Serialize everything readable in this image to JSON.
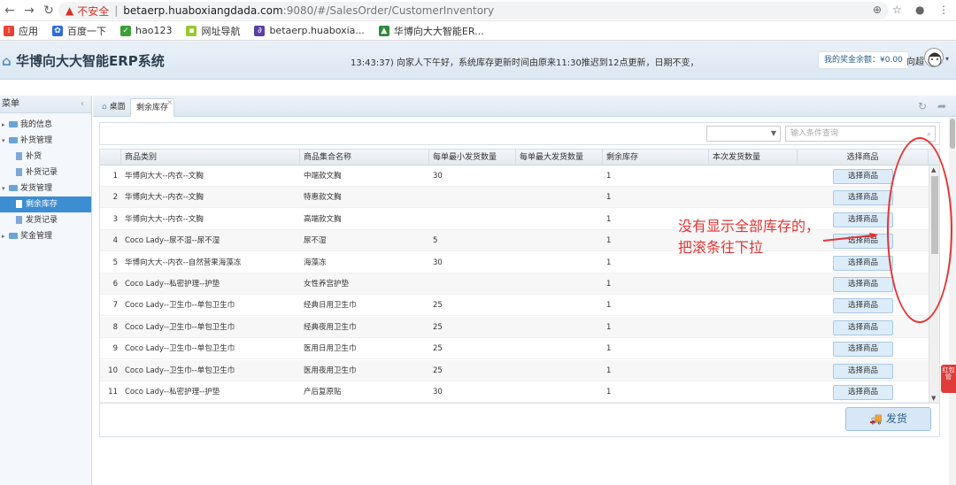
{
  "browser": {
    "insecure_label": "不安全",
    "url_host": "betaerp.huaboxiangdada.com",
    "url_port_path": ":9080/#/SalesOrder/CustomerInventory",
    "bookmarks": [
      {
        "label": "应用"
      },
      {
        "label": "百度一下"
      },
      {
        "label": "hao123"
      },
      {
        "label": "网址导航"
      },
      {
        "label": "betaerp.huaboxia..."
      },
      {
        "label": "华博向大大智能ER..."
      }
    ]
  },
  "header": {
    "title": "华博向大大智能ERP系统",
    "notice": "13:43:37) 向家人下午好，系统库存更新时间由原来11:30推迟到12点更新，日期不变，",
    "bonus": "我的奖金余额：¥0.00",
    "user": "向超"
  },
  "sidebar": {
    "title": "菜单",
    "items": [
      {
        "label": "我的信息"
      },
      {
        "label": "补货管理"
      },
      {
        "label": "补货"
      },
      {
        "label": "补货记录"
      },
      {
        "label": "发货管理"
      },
      {
        "label": "剩余库存"
      },
      {
        "label": "发货记录"
      },
      {
        "label": "奖金管理"
      }
    ]
  },
  "tabs": {
    "home": "桌面",
    "active": "剩余库存"
  },
  "search": {
    "placeholder": "输入条件查询",
    "select_value": ""
  },
  "table": {
    "columns": [
      "商品类别",
      "商品集合名称",
      "每单最小发货数量",
      "每单最大发货数量",
      "剩余库存",
      "本次发货数量",
      "选择商品"
    ],
    "rows": [
      {
        "n": "1",
        "cat": "华博向大大--内衣--文胸",
        "name": "中端款文胸",
        "min": "30",
        "max": "",
        "stock": "1",
        "qty": ""
      },
      {
        "n": "2",
        "cat": "华博向大大--内衣--文胸",
        "name": "特惠款文胸",
        "min": "",
        "max": "",
        "stock": "1",
        "qty": ""
      },
      {
        "n": "3",
        "cat": "华博向大大--内衣--文胸",
        "name": "高端款文胸",
        "min": "",
        "max": "",
        "stock": "1",
        "qty": ""
      },
      {
        "n": "4",
        "cat": "Coco Lady--尿不湿--尿不湿",
        "name": "尿不湿",
        "min": "5",
        "max": "",
        "stock": "1",
        "qty": ""
      },
      {
        "n": "5",
        "cat": "华博向大大--内衣--自然营果海藻冻",
        "name": "海藻冻",
        "min": "30",
        "max": "",
        "stock": "1",
        "qty": ""
      },
      {
        "n": "6",
        "cat": "Coco Lady--私密护理--护垫",
        "name": "女性养宫护垫",
        "min": "",
        "max": "",
        "stock": "1",
        "qty": ""
      },
      {
        "n": "7",
        "cat": "Coco Lady--卫生巾--单包卫生巾",
        "name": "经典日用卫生巾",
        "min": "25",
        "max": "",
        "stock": "1",
        "qty": ""
      },
      {
        "n": "8",
        "cat": "Coco Lady--卫生巾--单包卫生巾",
        "name": "经典夜用卫生巾",
        "min": "25",
        "max": "",
        "stock": "1",
        "qty": ""
      },
      {
        "n": "9",
        "cat": "Coco Lady--卫生巾--单包卫生巾",
        "name": "医用日用卫生巾",
        "min": "25",
        "max": "",
        "stock": "1",
        "qty": ""
      },
      {
        "n": "10",
        "cat": "Coco Lady--卫生巾--单包卫生巾",
        "name": "医用夜用卫生巾",
        "min": "25",
        "max": "",
        "stock": "1",
        "qty": ""
      },
      {
        "n": "11",
        "cat": "Coco Lady--私密护理--护垫",
        "name": "产后复原贴",
        "min": "30",
        "max": "",
        "stock": "1",
        "qty": ""
      }
    ],
    "select_label": "选择商品"
  },
  "ship_button": "发货",
  "side_tag": "红包管",
  "annotation": "没有显示全部库存的，把滚条往下拉",
  "colors": {
    "annotation": "#e53333",
    "active_menu": "#3c8dd2"
  }
}
